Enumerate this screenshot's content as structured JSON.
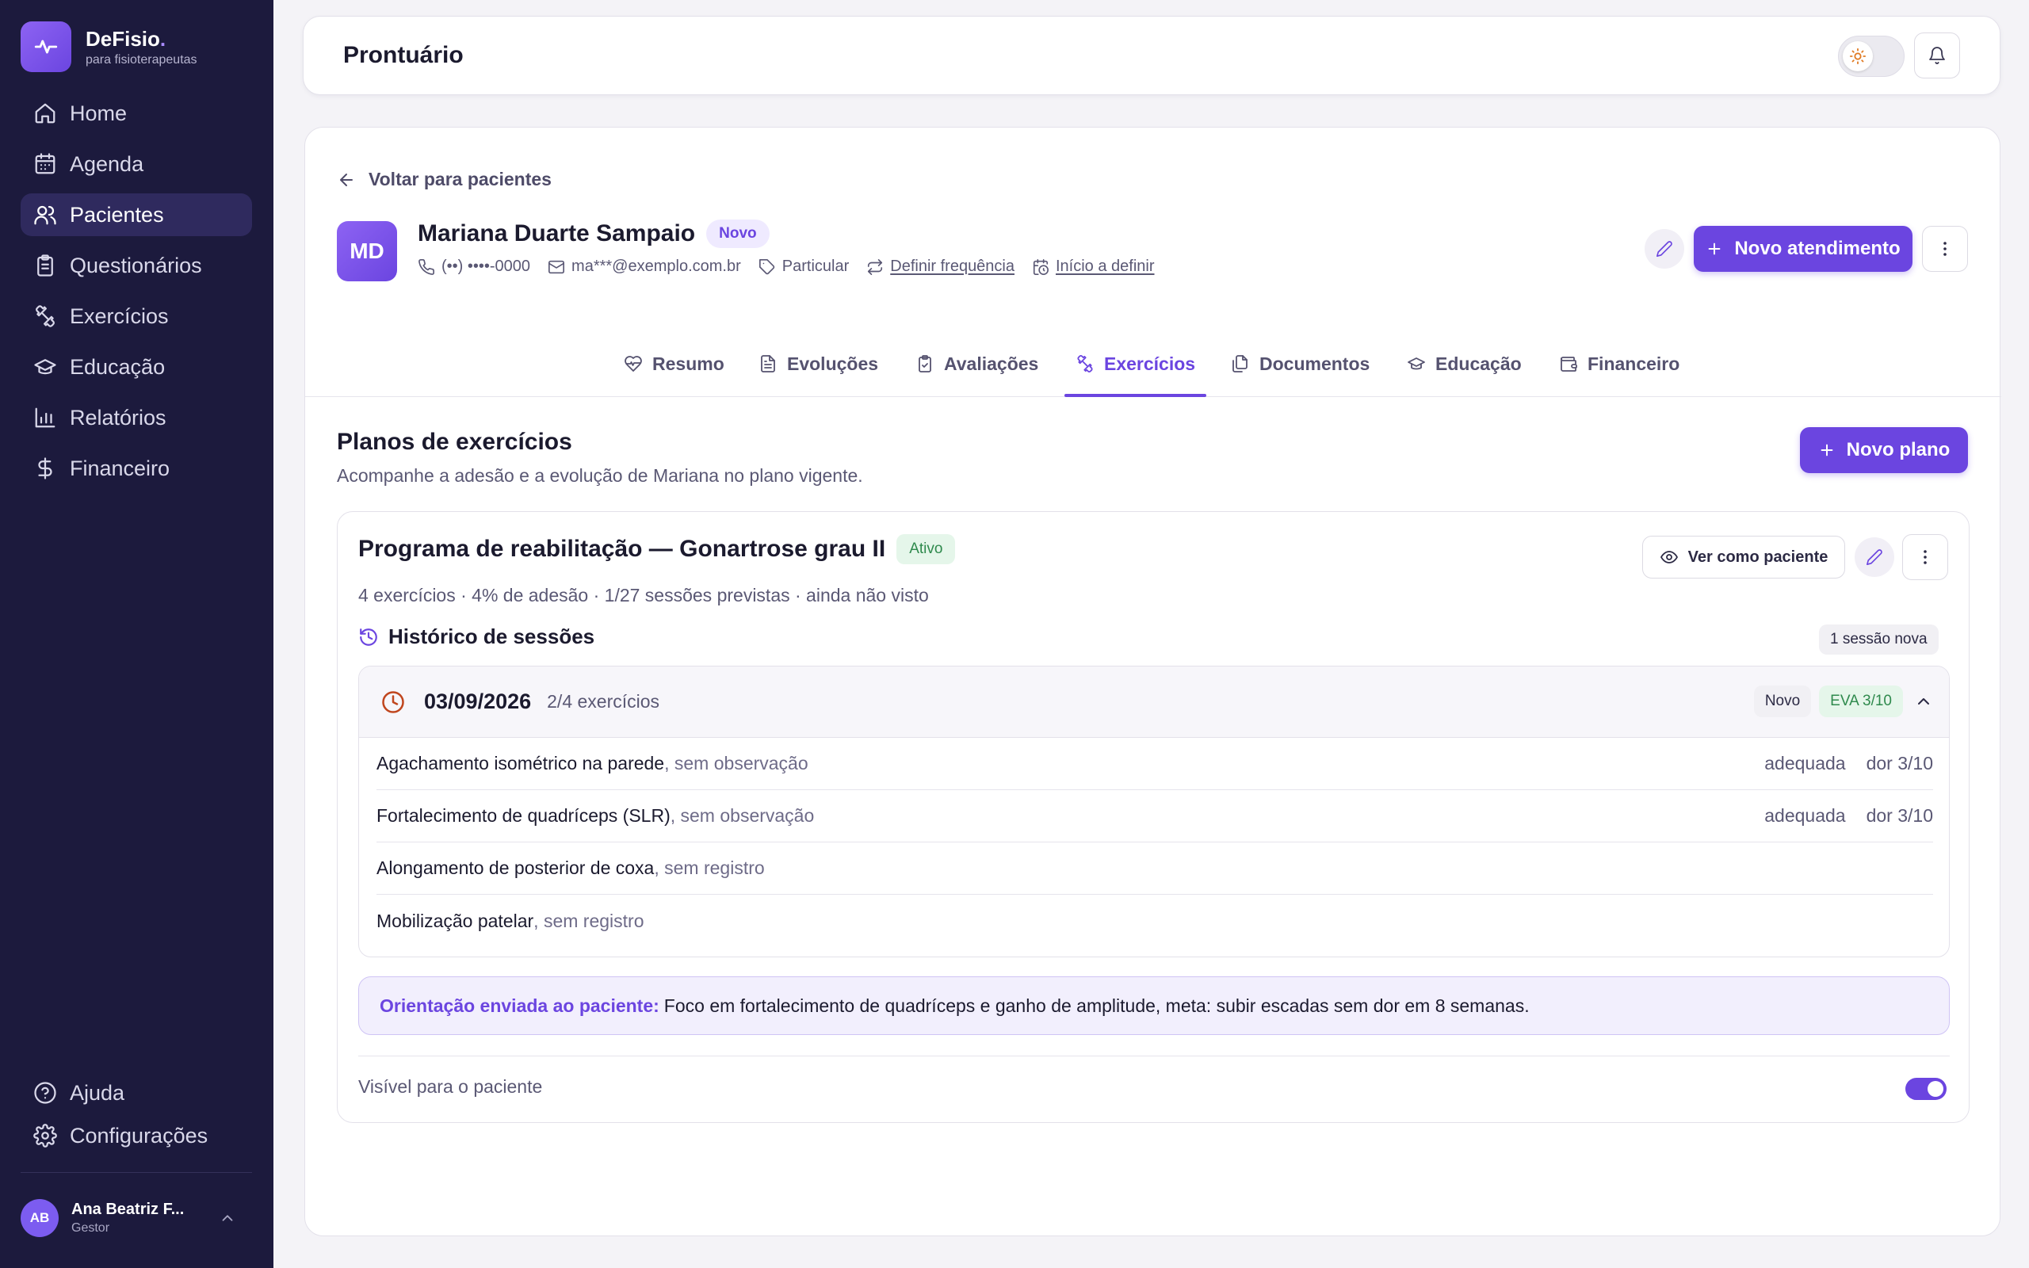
{
  "brand": {
    "name": "DeFisio",
    "dot": ".",
    "subtitle": "para fisioterapeutas"
  },
  "sidebar": {
    "items": [
      {
        "label": "Home",
        "icon": "home-icon"
      },
      {
        "label": "Agenda",
        "icon": "calendar-icon"
      },
      {
        "label": "Pacientes",
        "icon": "users-icon",
        "active": true
      },
      {
        "label": "Questionários",
        "icon": "clipboard-icon"
      },
      {
        "label": "Exercícios",
        "icon": "dumbbell-icon"
      },
      {
        "label": "Educação",
        "icon": "graduation-cap-icon"
      },
      {
        "label": "Relatórios",
        "icon": "bar-chart-icon"
      },
      {
        "label": "Financeiro",
        "icon": "dollar-icon"
      }
    ],
    "bottom": [
      {
        "label": "Ajuda",
        "icon": "help-icon"
      },
      {
        "label": "Configurações",
        "icon": "gear-icon"
      }
    ],
    "user": {
      "initials": "AB",
      "name": "Ana Beatriz F...",
      "role": "Gestor"
    }
  },
  "topbar": {
    "title": "Prontuário"
  },
  "patient": {
    "back_label": "Voltar para pacientes",
    "initials": "MD",
    "name": "Mariana Duarte Sampaio",
    "badge": "Novo",
    "phone": "(••) ••••-0000",
    "email": "ma***@exemplo.com.br",
    "plan": "Particular",
    "frequency": "Definir frequência",
    "start": "Início a definir",
    "new_appointment_label": "Novo atendimento"
  },
  "tabs": [
    {
      "label": "Resumo",
      "icon": "heart-pulse-icon"
    },
    {
      "label": "Evoluções",
      "icon": "file-text-icon"
    },
    {
      "label": "Avaliações",
      "icon": "clipboard-check-icon"
    },
    {
      "label": "Exercícios",
      "icon": "dumbbell-icon",
      "active": true
    },
    {
      "label": "Documentos",
      "icon": "files-icon"
    },
    {
      "label": "Educação",
      "icon": "graduation-cap-icon"
    },
    {
      "label": "Financeiro",
      "icon": "wallet-icon"
    }
  ],
  "plans_section": {
    "title": "Planos de exercícios",
    "subtitle": "Acompanhe a adesão e a evolução de Mariana no plano vigente.",
    "new_plan_label": "Novo plano"
  },
  "plan": {
    "title": "Programa de reabilitação — Gonartrose grau II",
    "status": "Ativo",
    "meta": "4 exercícios · 4% de adesão · 1/27 sessões previstas · ainda não visto",
    "view_as_patient_label": "Ver como paciente",
    "history_title": "Histórico de sessões",
    "new_sessions_badge": "1 sessão nova",
    "session": {
      "date": "03/09/2026",
      "count": "2/4 exercícios",
      "tag": "Novo",
      "eva": "EVA 3/10",
      "exercises": [
        {
          "name": "Agachamento isométrico na parede",
          "obs": ", sem observação",
          "effort": "adequada",
          "pain": "dor 3/10"
        },
        {
          "name": "Fortalecimento de quadríceps (SLR)",
          "obs": ", sem observação",
          "effort": "adequada",
          "pain": "dor 3/10"
        },
        {
          "name": "Alongamento de posterior de coxa",
          "obs": ", sem registro",
          "effort": "",
          "pain": ""
        },
        {
          "name": "Mobilização patelar",
          "obs": ", sem registro",
          "effort": "",
          "pain": ""
        }
      ]
    },
    "orientation_label": "Orientação enviada ao paciente:",
    "orientation_text": "Foco em fortalecimento de quadríceps e ganho de amplitude, meta: subir escadas sem dor em 8 semanas.",
    "visible_label": "Visível para o paciente",
    "visible": true
  },
  "colors": {
    "accent": "#6b45e0",
    "sidebar": "#1c1a3d",
    "success": "#2f8a4d"
  }
}
